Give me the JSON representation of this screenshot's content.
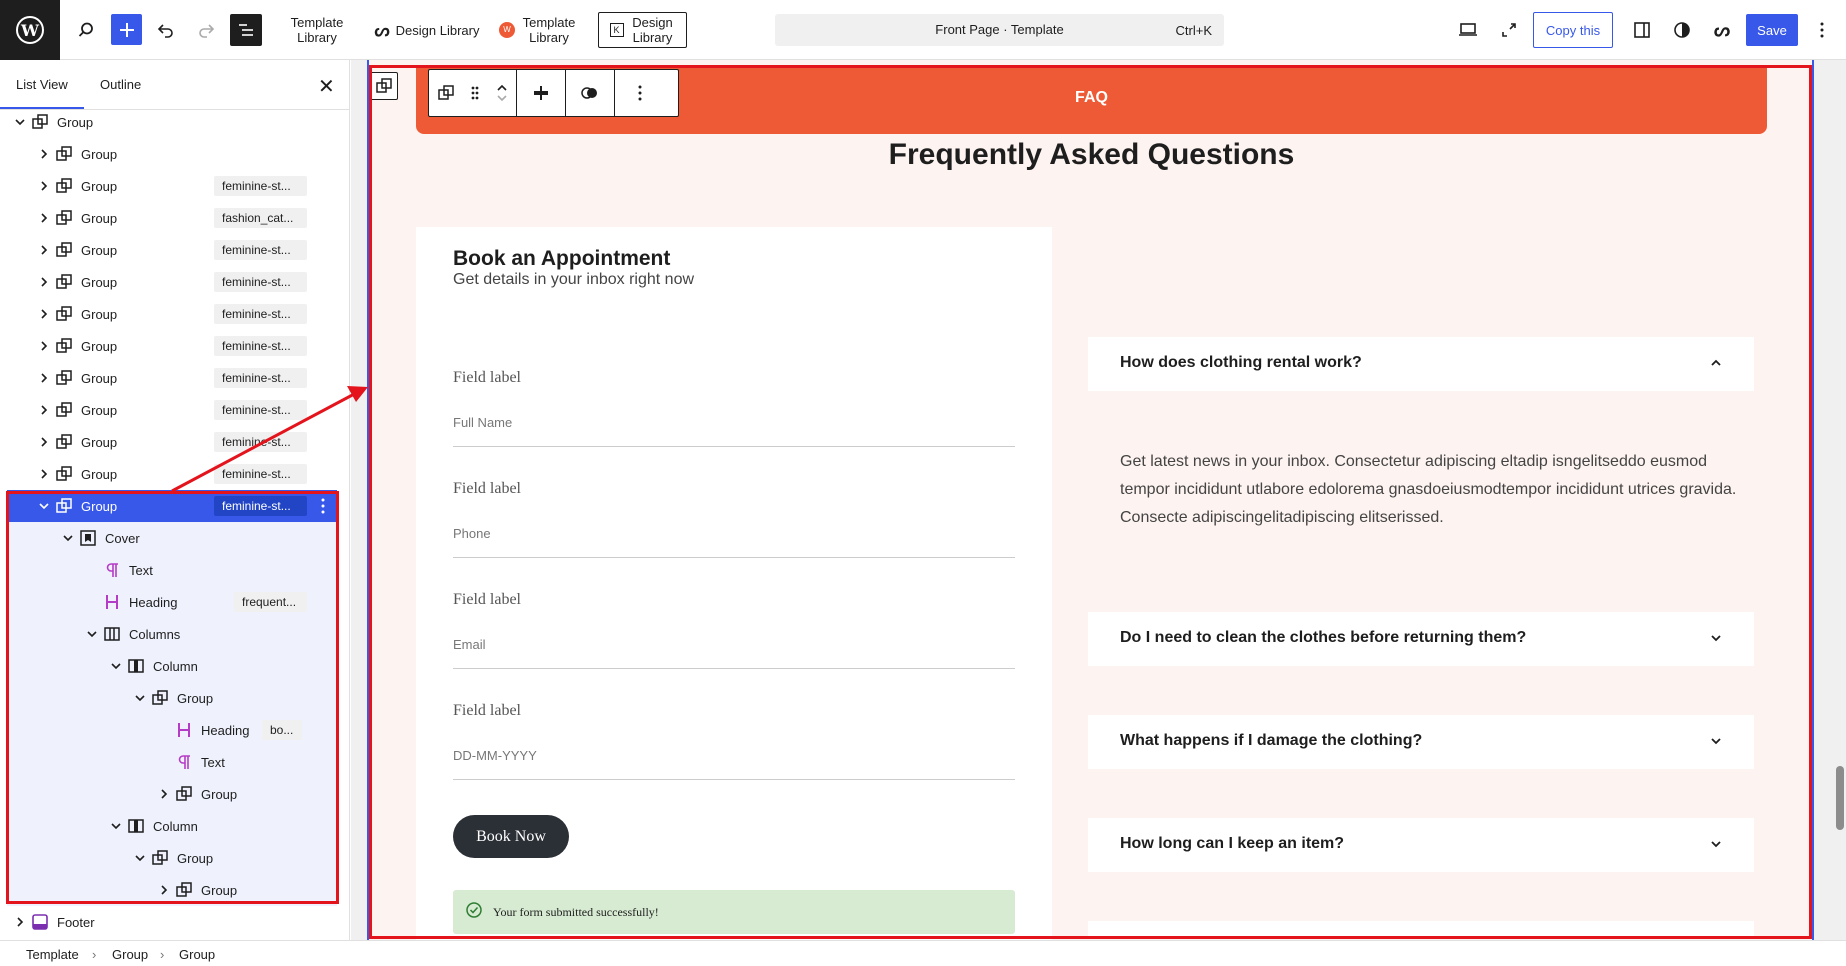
{
  "topbar": {
    "template_library_1": "Template Library",
    "design_library_1": "Design Library",
    "template_library_2": "Template Library",
    "design_library_2": "Design Library",
    "command_title": "Front Page · Template",
    "command_shortcut": "Ctrl+K",
    "copy_label": "Copy this",
    "save_label": "Save"
  },
  "sidebar": {
    "tab_list": "List View",
    "tab_outline": "Outline",
    "close": "✕",
    "rows": [
      {
        "label": "Group",
        "badge": ""
      },
      {
        "label": "Group",
        "badge": ""
      },
      {
        "label": "Group",
        "badge": "feminine-st..."
      },
      {
        "label": "Group",
        "badge": "fashion_cat..."
      },
      {
        "label": "Group",
        "badge": "feminine-st..."
      },
      {
        "label": "Group",
        "badge": "feminine-st..."
      },
      {
        "label": "Group",
        "badge": "feminine-st..."
      },
      {
        "label": "Group",
        "badge": "feminine-st..."
      },
      {
        "label": "Group",
        "badge": "feminine-st..."
      },
      {
        "label": "Group",
        "badge": "feminine-st..."
      },
      {
        "label": "Group",
        "badge": "feminine-st..."
      },
      {
        "label": "Group",
        "badge": "feminine-st..."
      },
      {
        "label": "Group",
        "badge": "feminine-st..."
      },
      {
        "label": "Cover",
        "badge": ""
      },
      {
        "label": "Text",
        "badge": ""
      },
      {
        "label": "Heading",
        "badge": "frequent..."
      },
      {
        "label": "Columns",
        "badge": ""
      },
      {
        "label": "Column",
        "badge": ""
      },
      {
        "label": "Group",
        "badge": ""
      },
      {
        "label": "Heading",
        "badge": "bo..."
      },
      {
        "label": "Text",
        "badge": ""
      },
      {
        "label": "Group",
        "badge": ""
      },
      {
        "label": "Column",
        "badge": ""
      },
      {
        "label": "Group",
        "badge": ""
      },
      {
        "label": "Group",
        "badge": ""
      },
      {
        "label": "Footer",
        "badge": ""
      }
    ]
  },
  "breadcrumbs": [
    "Template",
    "Group",
    "Group"
  ],
  "canvas": {
    "faq_bar": "FAQ",
    "title": "Frequently Asked Questions",
    "form": {
      "heading": "Book an Appointment",
      "subheading": "Get details in your inbox right now",
      "fields": [
        {
          "label": "Field label",
          "placeholder": "Full Name"
        },
        {
          "label": "Field label",
          "placeholder": "Phone"
        },
        {
          "label": "Field label",
          "placeholder": "Email"
        },
        {
          "label": "Field label",
          "placeholder": "DD-MM-YYYY"
        }
      ],
      "submit": "Book Now",
      "success": "Your form submitted successfully!"
    },
    "faqs": [
      {
        "q": "How does clothing rental work?",
        "open": true
      },
      {
        "q": "Do I need to clean the clothes before returning them?",
        "open": false
      },
      {
        "q": "What happens if I damage the clothing?",
        "open": false
      },
      {
        "q": "How long can I keep an item?",
        "open": false
      }
    ],
    "answer": "Get latest news in your inbox. Consectetur adipiscing eltadip isngelitseddo eusmod tempor incididunt utlabore edolorema gnasdoeiusmodtempor incididunt utrices gravida. Consecte adipiscingelitadipiscing elitserissed."
  },
  "colors": {
    "accent": "#3858e9",
    "faq_orange": "#ee5a36",
    "highlight_red": "#e4141d",
    "page_bg": "#fdf3f1"
  }
}
